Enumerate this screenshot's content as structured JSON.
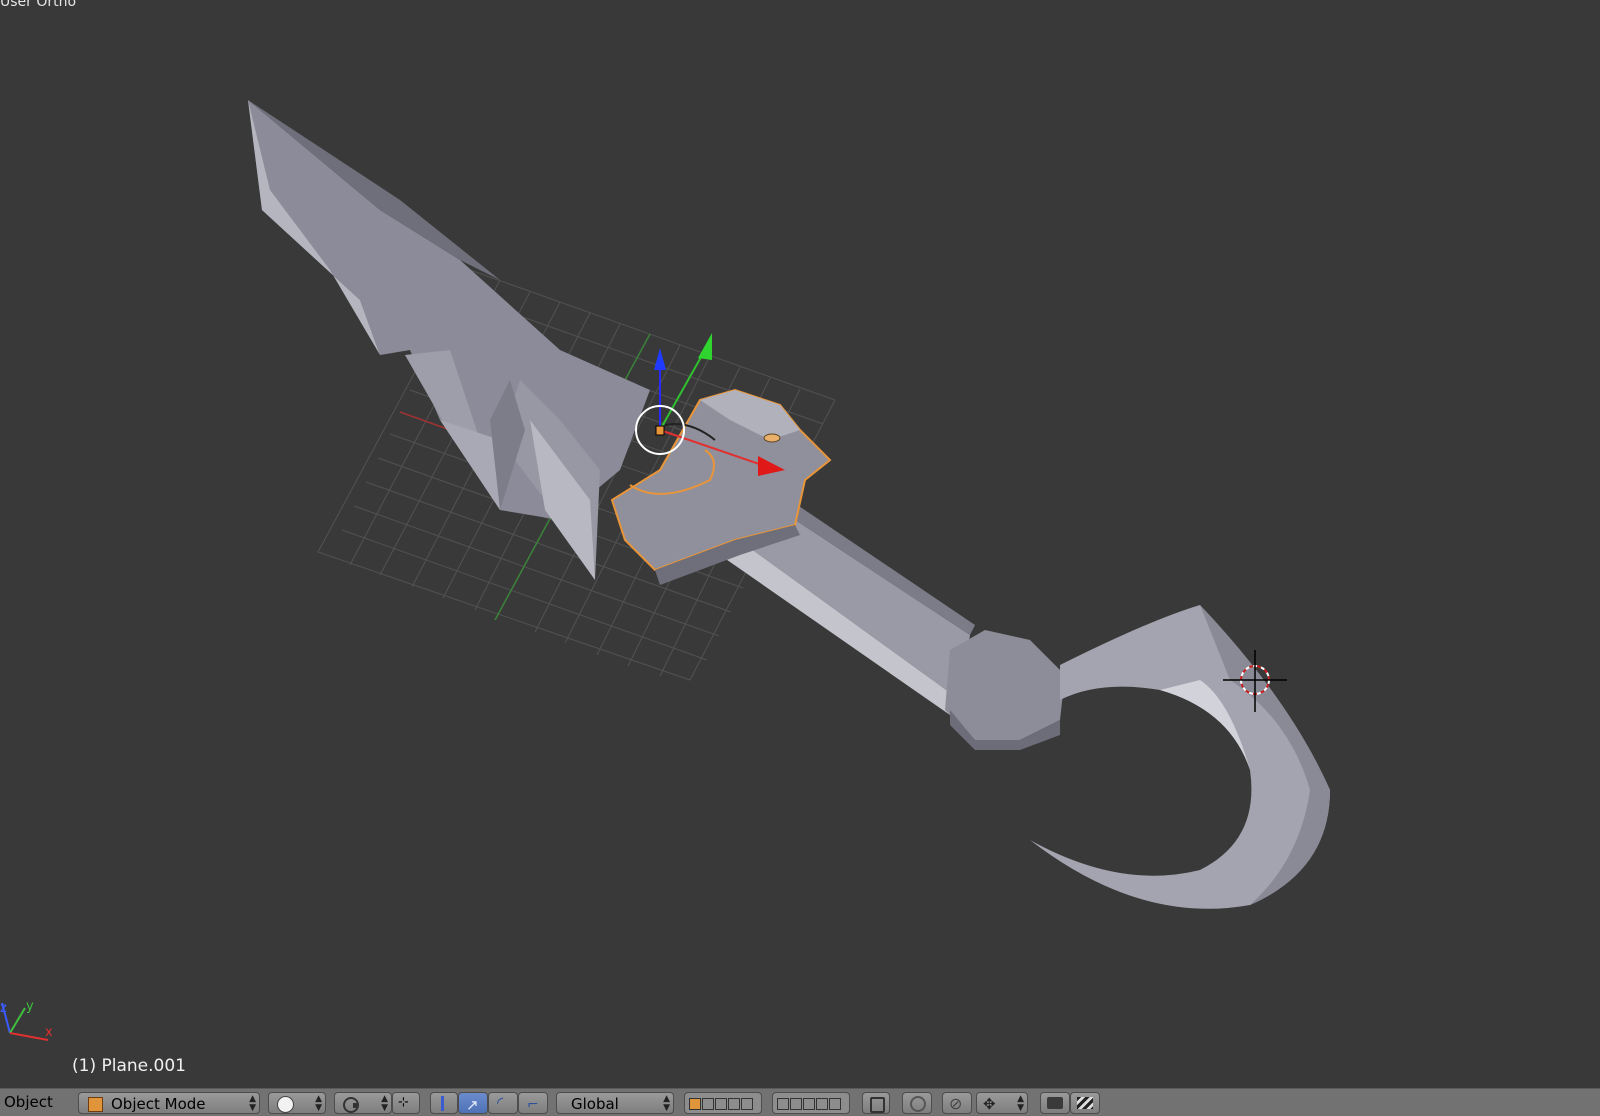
{
  "viewport": {
    "view_label": "User Ortho",
    "object_label": "(1) Plane.001",
    "background_color": "#393939",
    "selection_outline_color": "#e8953a",
    "mini_axes": [
      "z",
      "y",
      "x"
    ]
  },
  "header": {
    "menu_object": "Object",
    "mode_label": "Object Mode",
    "orientation_label": "Global",
    "icons": [
      "viewport-shading-solid-icon",
      "pivot-point-icon",
      "manipulator-toggle-icon",
      "translate-manipulator-icon",
      "rotate-manipulator-icon",
      "scale-manipulator-icon",
      "layers-icon",
      "lock-layers-icon",
      "proportional-edit-icon",
      "snap-icon",
      "snap-element-icon",
      "render-opengl-icon",
      "render-animation-icon"
    ]
  }
}
